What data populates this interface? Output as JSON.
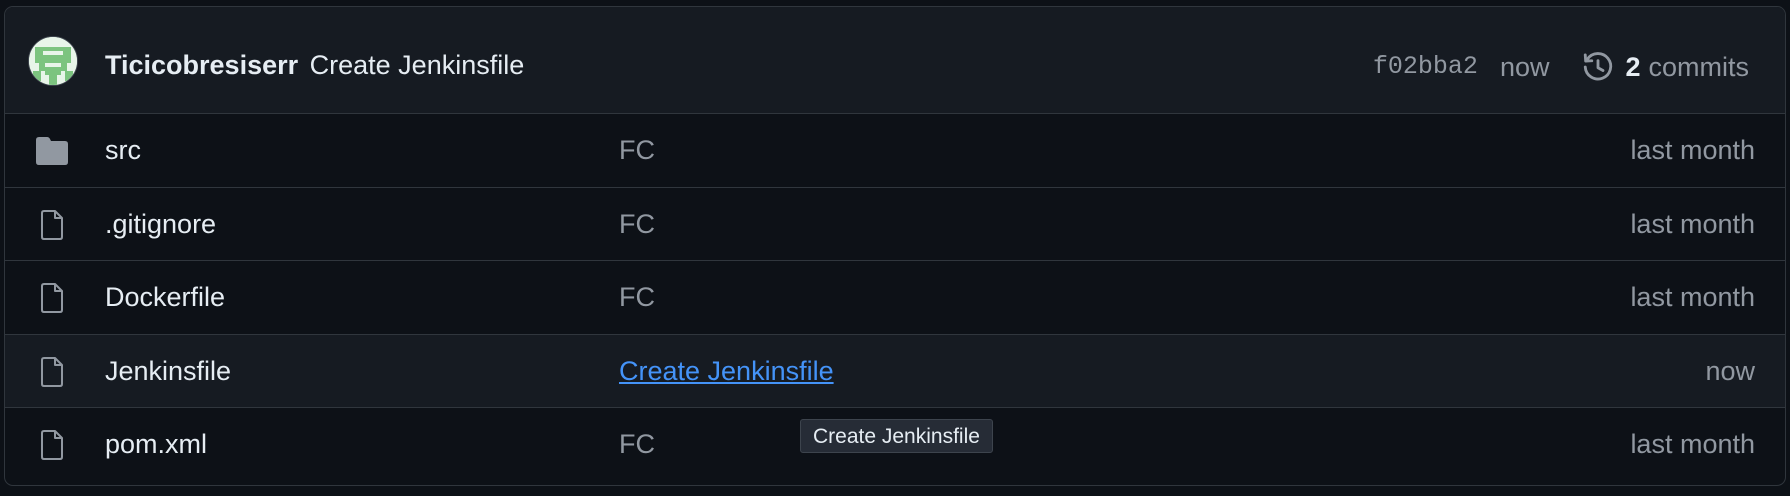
{
  "latest_commit": {
    "author": "Ticicobresiserr",
    "message": "Create Jenkinsfile",
    "sha": "f02bba2",
    "time": "now",
    "commits_count": "2",
    "commits_label": "commits",
    "avatar_icon": "identicon-avatar",
    "history_icon": "history-icon"
  },
  "files": [
    {
      "name": "src",
      "type": "folder",
      "icon": "folder-icon",
      "message": "FC",
      "age": "last month"
    },
    {
      "name": ".gitignore",
      "type": "file",
      "icon": "file-icon",
      "message": "FC",
      "age": "last month"
    },
    {
      "name": "Dockerfile",
      "type": "file",
      "icon": "file-icon",
      "message": "FC",
      "age": "last month"
    },
    {
      "name": "Jenkinsfile",
      "type": "file",
      "icon": "file-icon",
      "message": "Create Jenkinsfile",
      "age": "now"
    },
    {
      "name": "pom.xml",
      "type": "file",
      "icon": "file-icon",
      "message": "FC",
      "age": "last month"
    }
  ],
  "tooltip": {
    "text": "Create Jenkinsfile"
  },
  "colors": {
    "background": "#0d1117",
    "header_bg": "#161b22",
    "border": "#30363d",
    "text": "#e6edf3",
    "muted": "#9198a1",
    "link": "#4493f8",
    "avatar_green": "#7cc47f"
  }
}
